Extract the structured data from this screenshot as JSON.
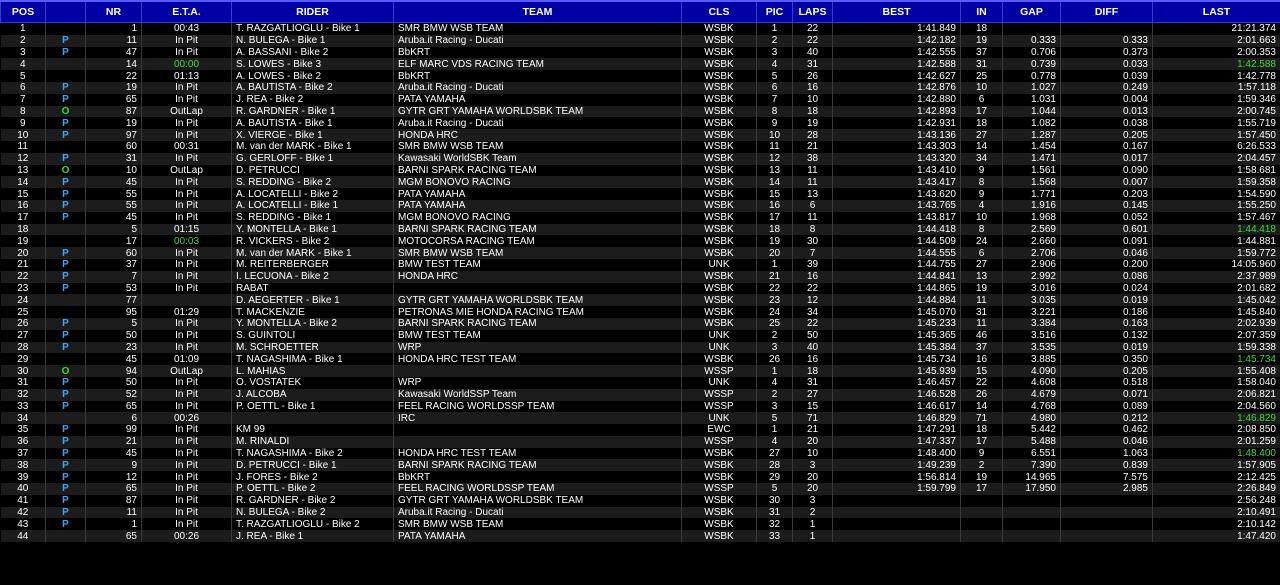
{
  "headers": {
    "pos": "POS",
    "flag": "",
    "nr": "NR",
    "eta": "E.T.A.",
    "rider": "RIDER",
    "team": "TEAM",
    "cls": "CLS",
    "pic": "PIC",
    "laps": "LAPS",
    "best": "BEST",
    "in": "IN",
    "gap": "GAP",
    "diff": "DIFF",
    "last": "LAST"
  },
  "colors": {
    "header_bg": "#0000a4",
    "pit_flag": "#43a3f0",
    "outlap_flag": "#3ddc3d",
    "highlight": "#3ddc3d"
  },
  "rows": [
    {
      "pos": "1",
      "flag": "",
      "nr": "1",
      "eta": "00:43",
      "rider": "T. RAZGATLIOGLU - Bike 1",
      "team": "SMR BMW WSB TEAM",
      "cls": "WSBK",
      "pic": "1",
      "laps": "22",
      "best": "1:41.849",
      "in": "18",
      "gap": "",
      "diff": "",
      "last": "21:21.374"
    },
    {
      "pos": "2",
      "flag": "P",
      "nr": "11",
      "eta": "In Pit",
      "rider": "N. BULEGA - Bike 1",
      "team": "Aruba.it Racing - Ducati",
      "cls": "WSBK",
      "pic": "2",
      "laps": "22",
      "best": "1:42.182",
      "in": "19",
      "gap": "0.333",
      "diff": "0.333",
      "last": "2:01.663"
    },
    {
      "pos": "3",
      "flag": "P",
      "nr": "47",
      "eta": "In Pit",
      "rider": "A. BASSANI - Bike 2",
      "team": "BbKRT",
      "cls": "WSBK",
      "pic": "3",
      "laps": "40",
      "best": "1:42.555",
      "in": "37",
      "gap": "0.706",
      "diff": "0.373",
      "last": "2:00.353"
    },
    {
      "pos": "4",
      "flag": "",
      "nr": "14",
      "eta": "00:00",
      "rider": "S. LOWES - Bike 3",
      "team": "ELF MARC VDS RACING TEAM",
      "cls": "WSBK",
      "pic": "4",
      "laps": "31",
      "best": "1:42.588",
      "in": "31",
      "gap": "0.739",
      "diff": "0.033",
      "last": "1:42.588",
      "etaGreen": true,
      "lastGreen": true
    },
    {
      "pos": "5",
      "flag": "",
      "nr": "22",
      "eta": "01:13",
      "rider": "A. LOWES - Bike 2",
      "team": "BbKRT",
      "cls": "WSBK",
      "pic": "5",
      "laps": "26",
      "best": "1:42.627",
      "in": "25",
      "gap": "0.778",
      "diff": "0.039",
      "last": "1:42.778"
    },
    {
      "pos": "6",
      "flag": "P",
      "nr": "19",
      "eta": "In Pit",
      "rider": "A. BAUTISTA - Bike 2",
      "team": "Aruba.it Racing - Ducati",
      "cls": "WSBK",
      "pic": "6",
      "laps": "16",
      "best": "1:42.876",
      "in": "10",
      "gap": "1.027",
      "diff": "0.249",
      "last": "1:57.118"
    },
    {
      "pos": "7",
      "flag": "P",
      "nr": "65",
      "eta": "In Pit",
      "rider": "J. REA - Bike 2",
      "team": "PATA YAMAHA",
      "cls": "WSBK",
      "pic": "7",
      "laps": "10",
      "best": "1:42.880",
      "in": "6",
      "gap": "1.031",
      "diff": "0.004",
      "last": "1:59.346"
    },
    {
      "pos": "8",
      "flag": "O",
      "nr": "87",
      "eta": "OutLap",
      "rider": "R. GARDNER - Bike 1",
      "team": "GYTR GRT YAMAHA WORLDSBK TEAM",
      "cls": "WSBK",
      "pic": "8",
      "laps": "18",
      "best": "1:42.893",
      "in": "17",
      "gap": "1.044",
      "diff": "0.013",
      "last": "2:00.745"
    },
    {
      "pos": "9",
      "flag": "P",
      "nr": "19",
      "eta": "In Pit",
      "rider": "A. BAUTISTA - Bike 1",
      "team": "Aruba.it Racing - Ducati",
      "cls": "WSBK",
      "pic": "9",
      "laps": "19",
      "best": "1:42.931",
      "in": "18",
      "gap": "1.082",
      "diff": "0.038",
      "last": "1:55.719"
    },
    {
      "pos": "10",
      "flag": "P",
      "nr": "97",
      "eta": "In Pit",
      "rider": "X. VIERGE - Bike 1",
      "team": "HONDA HRC",
      "cls": "WSBK",
      "pic": "10",
      "laps": "28",
      "best": "1:43.136",
      "in": "27",
      "gap": "1.287",
      "diff": "0.205",
      "last": "1:57.450"
    },
    {
      "pos": "11",
      "flag": "",
      "nr": "60",
      "eta": "00:31",
      "rider": "M. van der MARK - Bike 1",
      "team": "SMR BMW WSB TEAM",
      "cls": "WSBK",
      "pic": "11",
      "laps": "21",
      "best": "1:43.303",
      "in": "14",
      "gap": "1.454",
      "diff": "0.167",
      "last": "6:26.533"
    },
    {
      "pos": "12",
      "flag": "P",
      "nr": "31",
      "eta": "In Pit",
      "rider": "G. GERLOFF - Bike 1",
      "team": "Kawasaki WorldSBK Team",
      "cls": "WSBK",
      "pic": "12",
      "laps": "38",
      "best": "1:43.320",
      "in": "34",
      "gap": "1.471",
      "diff": "0.017",
      "last": "2:04.457"
    },
    {
      "pos": "13",
      "flag": "O",
      "nr": "10",
      "eta": "OutLap",
      "rider": "D. PETRUCCI",
      "team": "BARNI SPARK RACING TEAM",
      "cls": "WSBK",
      "pic": "13",
      "laps": "11",
      "best": "1:43.410",
      "in": "9",
      "gap": "1.561",
      "diff": "0.090",
      "last": "1:58.681"
    },
    {
      "pos": "14",
      "flag": "P",
      "nr": "45",
      "eta": "In Pit",
      "rider": "S. REDDING - Bike 2",
      "team": "MGM BONOVO RACING",
      "cls": "WSBK",
      "pic": "14",
      "laps": "11",
      "best": "1:43.417",
      "in": "8",
      "gap": "1.568",
      "diff": "0.007",
      "last": "1:59.358"
    },
    {
      "pos": "15",
      "flag": "P",
      "nr": "55",
      "eta": "In Pit",
      "rider": "A. LOCATELLI - Bike 2",
      "team": "PATA YAMAHA",
      "cls": "WSBK",
      "pic": "15",
      "laps": "13",
      "best": "1:43.620",
      "in": "9",
      "gap": "1.771",
      "diff": "0.203",
      "last": "1:54.590"
    },
    {
      "pos": "16",
      "flag": "P",
      "nr": "55",
      "eta": "In Pit",
      "rider": "A. LOCATELLI - Bike 1",
      "team": "PATA YAMAHA",
      "cls": "WSBK",
      "pic": "16",
      "laps": "6",
      "best": "1:43.765",
      "in": "4",
      "gap": "1.916",
      "diff": "0.145",
      "last": "1:55.250"
    },
    {
      "pos": "17",
      "flag": "P",
      "nr": "45",
      "eta": "In Pit",
      "rider": "S. REDDING - Bike 1",
      "team": "MGM BONOVO RACING",
      "cls": "WSBK",
      "pic": "17",
      "laps": "11",
      "best": "1:43.817",
      "in": "10",
      "gap": "1.968",
      "diff": "0.052",
      "last": "1:57.467"
    },
    {
      "pos": "18",
      "flag": "",
      "nr": "5",
      "eta": "01:15",
      "rider": "Y. MONTELLA - Bike 1",
      "team": "BARNI SPARK RACING TEAM",
      "cls": "WSBK",
      "pic": "18",
      "laps": "8",
      "best": "1:44.418",
      "in": "8",
      "gap": "2.569",
      "diff": "0.601",
      "last": "1:44.418",
      "lastGreen": true
    },
    {
      "pos": "19",
      "flag": "",
      "nr": "17",
      "eta": "00:03",
      "rider": "R. VICKERS - Bike 2",
      "team": "MOTOCORSA RACING TEAM",
      "cls": "WSBK",
      "pic": "19",
      "laps": "30",
      "best": "1:44.509",
      "in": "24",
      "gap": "2.660",
      "diff": "0.091",
      "last": "1:44.881",
      "etaGreen": true
    },
    {
      "pos": "20",
      "flag": "P",
      "nr": "60",
      "eta": "In Pit",
      "rider": "M. van der MARK - Bike 1",
      "team": "SMR BMW WSB TEAM",
      "cls": "WSBK",
      "pic": "20",
      "laps": "7",
      "best": "1:44.555",
      "in": "6",
      "gap": "2.706",
      "diff": "0.046",
      "last": "1:59.772"
    },
    {
      "pos": "21",
      "flag": "P",
      "nr": "37",
      "eta": "In Pit",
      "rider": "M. REITERBERGER",
      "team": "BMW TEST TEAM",
      "cls": "UNK",
      "pic": "1",
      "laps": "39",
      "best": "1:44.755",
      "in": "27",
      "gap": "2.906",
      "diff": "0.200",
      "last": "14:05.960"
    },
    {
      "pos": "22",
      "flag": "P",
      "nr": "7",
      "eta": "In Pit",
      "rider": "I. LECUONA - Bike 2",
      "team": "HONDA HRC",
      "cls": "WSBK",
      "pic": "21",
      "laps": "16",
      "best": "1:44.841",
      "in": "13",
      "gap": "2.992",
      "diff": "0.086",
      "last": "2:37.989"
    },
    {
      "pos": "23",
      "flag": "P",
      "nr": "53",
      "eta": "In Pit",
      "rider": "RABAT",
      "team": "",
      "cls": "WSBK",
      "pic": "22",
      "laps": "22",
      "best": "1:44.865",
      "in": "19",
      "gap": "3.016",
      "diff": "0.024",
      "last": "2:01.682"
    },
    {
      "pos": "24",
      "flag": "",
      "nr": "77",
      "eta": "",
      "rider": "D. AEGERTER - Bike 1",
      "team": "GYTR GRT YAMAHA WORLDSBK TEAM",
      "cls": "WSBK",
      "pic": "23",
      "laps": "12",
      "best": "1:44.884",
      "in": "11",
      "gap": "3.035",
      "diff": "0.019",
      "last": "1:45.042"
    },
    {
      "pos": "25",
      "flag": "",
      "nr": "95",
      "eta": "01:29",
      "rider": "T. MACKENZIE",
      "team": "PETRONAS MIE HONDA RACING TEAM",
      "cls": "WSBK",
      "pic": "24",
      "laps": "34",
      "best": "1:45.070",
      "in": "31",
      "gap": "3.221",
      "diff": "0.186",
      "last": "1:45.840"
    },
    {
      "pos": "26",
      "flag": "P",
      "nr": "5",
      "eta": "In Pit",
      "rider": "Y. MONTELLA - Bike 2",
      "team": "BARNI SPARK RACING TEAM",
      "cls": "WSBK",
      "pic": "25",
      "laps": "22",
      "best": "1:45.233",
      "in": "11",
      "gap": "3.384",
      "diff": "0.163",
      "last": "2:02.939"
    },
    {
      "pos": "27",
      "flag": "P",
      "nr": "50",
      "eta": "In Pit",
      "rider": "S. GUINTOLI",
      "team": "BMW TEST TEAM",
      "cls": "UNK",
      "pic": "2",
      "laps": "50",
      "best": "1:45.365",
      "in": "46",
      "gap": "3.516",
      "diff": "0.132",
      "last": "2:07.359"
    },
    {
      "pos": "28",
      "flag": "P",
      "nr": "23",
      "eta": "In Pit",
      "rider": "M. SCHROETTER",
      "team": "WRP",
      "cls": "UNK",
      "pic": "3",
      "laps": "40",
      "best": "1:45.384",
      "in": "37",
      "gap": "3.535",
      "diff": "0.019",
      "last": "1:59.338"
    },
    {
      "pos": "29",
      "flag": "",
      "nr": "45",
      "eta": "01:09",
      "rider": "T. NAGASHIMA - Bike 1",
      "team": "HONDA HRC TEST TEAM",
      "cls": "WSBK",
      "pic": "26",
      "laps": "16",
      "best": "1:45.734",
      "in": "16",
      "gap": "3.885",
      "diff": "0.350",
      "last": "1:45.734",
      "lastGreen": true
    },
    {
      "pos": "30",
      "flag": "O",
      "nr": "94",
      "eta": "OutLap",
      "rider": "L. MAHIAS",
      "team": "",
      "cls": "WSSP",
      "pic": "1",
      "laps": "18",
      "best": "1:45.939",
      "in": "15",
      "gap": "4.090",
      "diff": "0.205",
      "last": "1:55.408"
    },
    {
      "pos": "31",
      "flag": "P",
      "nr": "50",
      "eta": "In Pit",
      "rider": "O. VOSTATEK",
      "team": "WRP",
      "cls": "UNK",
      "pic": "4",
      "laps": "31",
      "best": "1:46.457",
      "in": "22",
      "gap": "4.608",
      "diff": "0.518",
      "last": "1:58.040"
    },
    {
      "pos": "32",
      "flag": "P",
      "nr": "52",
      "eta": "In Pit",
      "rider": "J. ALCOBA",
      "team": "Kawasaki WorldSSP Team",
      "cls": "WSSP",
      "pic": "2",
      "laps": "27",
      "best": "1:46.528",
      "in": "26",
      "gap": "4.679",
      "diff": "0.071",
      "last": "2:06.821"
    },
    {
      "pos": "33",
      "flag": "P",
      "nr": "65",
      "eta": "In Pit",
      "rider": "P. OETTL - Bike 1",
      "team": "FEEL RACING WORLDSSP TEAM",
      "cls": "WSSP",
      "pic": "3",
      "laps": "15",
      "best": "1:46.617",
      "in": "14",
      "gap": "4.768",
      "diff": "0.089",
      "last": "2:04.560"
    },
    {
      "pos": "34",
      "flag": "",
      "nr": "6",
      "eta": "00:26",
      "rider": "",
      "team": "IRC",
      "cls": "UNK",
      "pic": "5",
      "laps": "71",
      "best": "1:46.829",
      "in": "71",
      "gap": "4.980",
      "diff": "0.212",
      "last": "1:46.829",
      "lastGreen": true
    },
    {
      "pos": "35",
      "flag": "P",
      "nr": "99",
      "eta": "In Pit",
      "rider": "KM 99",
      "team": "",
      "cls": "EWC",
      "pic": "1",
      "laps": "21",
      "best": "1:47.291",
      "in": "18",
      "gap": "5.442",
      "diff": "0.462",
      "last": "2:08.850"
    },
    {
      "pos": "36",
      "flag": "P",
      "nr": "21",
      "eta": "In Pit",
      "rider": "M. RINALDI",
      "team": "",
      "cls": "WSSP",
      "pic": "4",
      "laps": "20",
      "best": "1:47.337",
      "in": "17",
      "gap": "5.488",
      "diff": "0.046",
      "last": "2:01.259"
    },
    {
      "pos": "37",
      "flag": "P",
      "nr": "45",
      "eta": "In Pit",
      "rider": "T. NAGASHIMA - Bike 2",
      "team": "HONDA HRC TEST TEAM",
      "cls": "WSBK",
      "pic": "27",
      "laps": "10",
      "best": "1:48.400",
      "in": "9",
      "gap": "6.551",
      "diff": "1.063",
      "last": "1:48.400",
      "lastGreen": true
    },
    {
      "pos": "38",
      "flag": "P",
      "nr": "9",
      "eta": "In Pit",
      "rider": "D. PETRUCCI - Bike 1",
      "team": "BARNI SPARK RACING TEAM",
      "cls": "WSBK",
      "pic": "28",
      "laps": "3",
      "best": "1:49.239",
      "in": "2",
      "gap": "7.390",
      "diff": "0.839",
      "last": "1:57.905"
    },
    {
      "pos": "39",
      "flag": "P",
      "nr": "12",
      "eta": "In Pit",
      "rider": "J. FORES - Bike 2",
      "team": "BbKRT",
      "cls": "WSBK",
      "pic": "29",
      "laps": "20",
      "best": "1:56.814",
      "in": "19",
      "gap": "14.965",
      "diff": "7.575",
      "last": "2:12.425"
    },
    {
      "pos": "40",
      "flag": "P",
      "nr": "65",
      "eta": "In Pit",
      "rider": "P. OETTL - Bike 2",
      "team": "FEEL RACING WORLDSSP TEAM",
      "cls": "WSSP",
      "pic": "5",
      "laps": "20",
      "best": "1:59.799",
      "in": "17",
      "gap": "17.950",
      "diff": "2.985",
      "last": "2:26.849"
    },
    {
      "pos": "41",
      "flag": "P",
      "nr": "87",
      "eta": "In Pit",
      "rider": "R. GARDNER - Bike 2",
      "team": "GYTR GRT YAMAHA WORLDSBK TEAM",
      "cls": "WSBK",
      "pic": "30",
      "laps": "3",
      "best": "",
      "in": "",
      "gap": "",
      "diff": "",
      "last": "2:56.248"
    },
    {
      "pos": "42",
      "flag": "P",
      "nr": "11",
      "eta": "In Pit",
      "rider": "N. BULEGA - Bike 2",
      "team": "Aruba.it Racing - Ducati",
      "cls": "WSBK",
      "pic": "31",
      "laps": "2",
      "best": "",
      "in": "",
      "gap": "",
      "diff": "",
      "last": "2:10.491"
    },
    {
      "pos": "43",
      "flag": "P",
      "nr": "1",
      "eta": "In Pit",
      "rider": "T. RAZGATLIOGLU - Bike 2",
      "team": "SMR BMW WSB TEAM",
      "cls": "WSBK",
      "pic": "32",
      "laps": "1",
      "best": "",
      "in": "",
      "gap": "",
      "diff": "",
      "last": "2:10.142"
    },
    {
      "pos": "44",
      "flag": "",
      "nr": "65",
      "eta": "00:26",
      "rider": "J. REA - Bike 1",
      "team": "PATA YAMAHA",
      "cls": "WSBK",
      "pic": "33",
      "laps": "1",
      "best": "",
      "in": "",
      "gap": "",
      "diff": "",
      "last": "1:47.420"
    }
  ]
}
